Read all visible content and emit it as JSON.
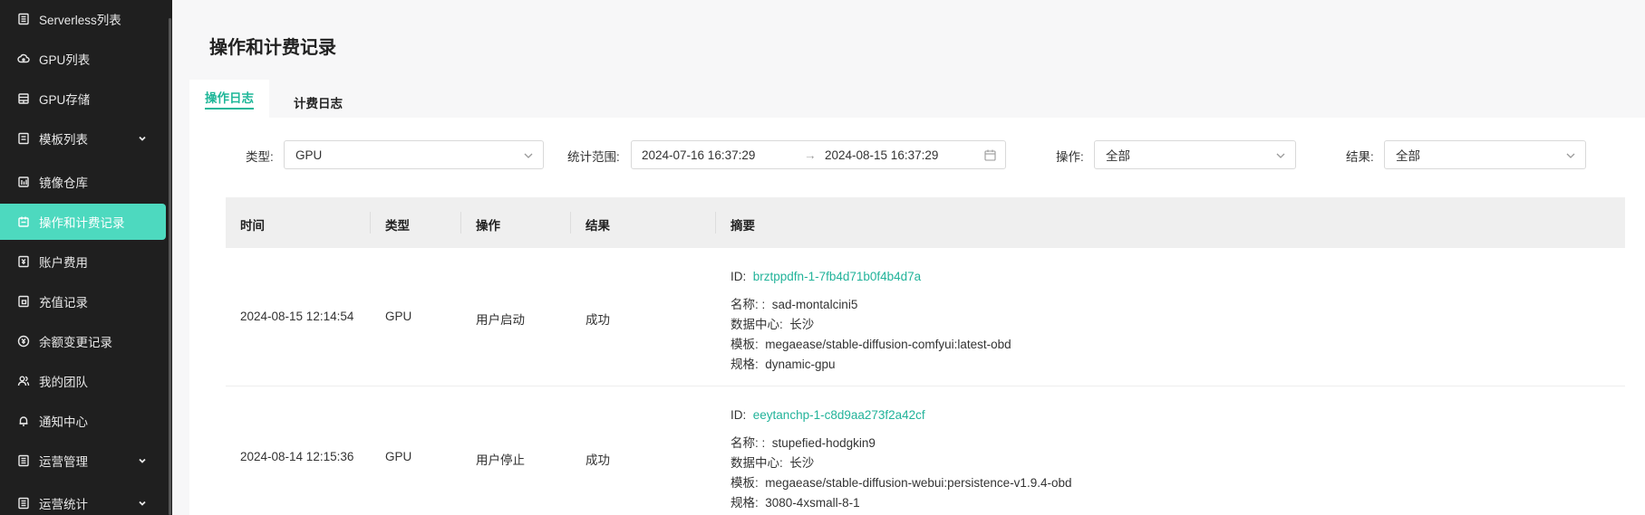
{
  "sidebar": {
    "items": [
      {
        "label": "Serverless列表",
        "icon": "list-icon"
      },
      {
        "label": "GPU列表",
        "icon": "cloud-icon"
      },
      {
        "label": "GPU存储",
        "icon": "storage-icon"
      },
      {
        "label": "模板列表",
        "icon": "template-icon"
      },
      {
        "label": "镜像仓库",
        "icon": "image-repo-icon"
      },
      {
        "label": "操作和计费记录",
        "icon": "record-icon"
      },
      {
        "label": "账户费用",
        "icon": "account-fee-icon"
      },
      {
        "label": "充值记录",
        "icon": "recharge-icon"
      },
      {
        "label": "余额变更记录",
        "icon": "balance-icon"
      },
      {
        "label": "我的团队",
        "icon": "team-icon"
      },
      {
        "label": "通知中心",
        "icon": "bell-icon"
      },
      {
        "label": "运营管理",
        "icon": "ops-icon"
      },
      {
        "label": "运营统计",
        "icon": "stats-icon"
      }
    ]
  },
  "page": {
    "title": "操作和计费记录"
  },
  "tabs": [
    {
      "label": "操作日志"
    },
    {
      "label": "计费日志"
    }
  ],
  "filters": {
    "type_label": "类型:",
    "type_value": "GPU",
    "range_label": "统计范围:",
    "range_start": "2024-07-16 16:37:29",
    "range_sep": "→",
    "range_end": "2024-08-15 16:37:29",
    "action_label": "操作:",
    "action_value": "全部",
    "result_label": "结果:",
    "result_value": "全部"
  },
  "table": {
    "headers": [
      "时间",
      "类型",
      "操作",
      "结果",
      "摘要"
    ],
    "rows": [
      {
        "time": "2024-08-15 12:14:54",
        "type": "GPU",
        "action": "用户启动",
        "result": "成功",
        "summary": {
          "id_key": "ID:",
          "id": "brztppdfn-1-7fb4d71b0f4b4d7a",
          "name_key": "名称: :",
          "name": "sad-montalcini5",
          "dc_key": "数据中心:",
          "dc": "长沙",
          "tpl_key": "模板:",
          "tpl": "megaease/stable-diffusion-comfyui:latest-obd",
          "spec_key": "规格:",
          "spec": "dynamic-gpu"
        }
      },
      {
        "time": "2024-08-14 12:15:36",
        "type": "GPU",
        "action": "用户停止",
        "result": "成功",
        "summary": {
          "id_key": "ID:",
          "id": "eeytanchp-1-c8d9aa273f2a42cf",
          "name_key": "名称: :",
          "name": "stupefied-hodgkin9",
          "dc_key": "数据中心:",
          "dc": "长沙",
          "tpl_key": "模板:",
          "tpl": "megaease/stable-diffusion-webui:persistence-v1.9.4-obd",
          "spec_key": "规格:",
          "spec": "3080-4xsmall-8-1"
        }
      }
    ]
  },
  "colors": {
    "accent": "#4dd9bf",
    "link": "#22b39a",
    "sidebar_bg": "#1f1f1f"
  }
}
